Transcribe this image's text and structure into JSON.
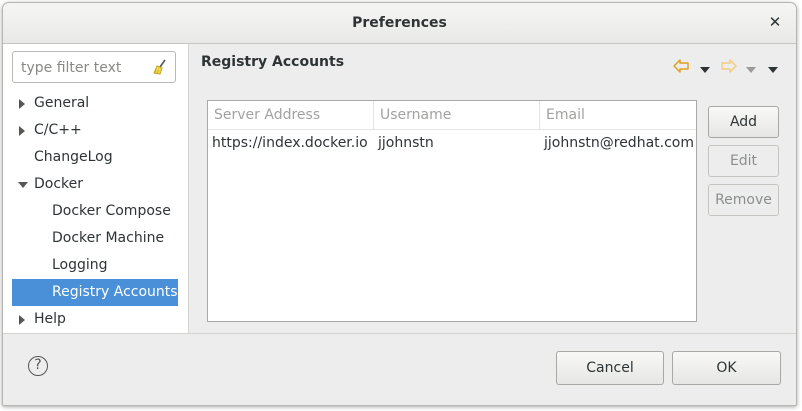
{
  "window": {
    "title": "Preferences",
    "close_glyph": "✕"
  },
  "filter": {
    "placeholder": "type filter text",
    "value": ""
  },
  "tree": {
    "items": [
      {
        "label": "General",
        "expandable": true,
        "expanded": false
      },
      {
        "label": "C/C++",
        "expandable": true,
        "expanded": false
      },
      {
        "label": "ChangeLog",
        "expandable": false
      },
      {
        "label": "Docker",
        "expandable": true,
        "expanded": true
      },
      {
        "label": "Docker Compose",
        "expandable": false
      },
      {
        "label": "Docker Machine",
        "expandable": false
      },
      {
        "label": "Logging",
        "expandable": false
      },
      {
        "label": "Registry Accounts",
        "expandable": false,
        "selected": true
      },
      {
        "label": "Help",
        "expandable": true,
        "expanded": false
      }
    ]
  },
  "page": {
    "title": "Registry Accounts"
  },
  "table": {
    "columns": [
      "Server Address",
      "Username",
      "Email"
    ],
    "rows": [
      {
        "server": "https://index.docker.io",
        "username": "jjohnstn",
        "email": "jjohnstn@redhat.com"
      }
    ]
  },
  "side_buttons": {
    "add": "Add",
    "edit": "Edit",
    "remove": "Remove"
  },
  "footer": {
    "cancel": "Cancel",
    "ok": "OK",
    "help_glyph": "?"
  },
  "colors": {
    "selection": "#4a90d9",
    "nav_arrow": "#f0b73a",
    "nav_arrow_disabled": "#f5d79a"
  },
  "icons": [
    "broom-icon",
    "back-arrow-icon",
    "forward-arrow-icon",
    "dropdown-icon",
    "menu-icon",
    "help-icon",
    "close-icon",
    "expand-arrow-icon"
  ]
}
